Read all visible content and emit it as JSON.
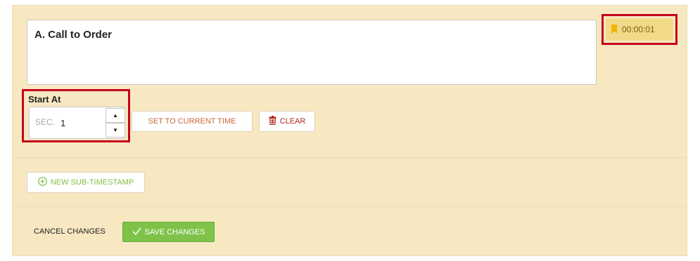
{
  "item": {
    "title": "A. Call to Order",
    "timestamp": "00:00:01"
  },
  "start_at": {
    "label": "Start At",
    "unit": "SEC.",
    "value": "1"
  },
  "buttons": {
    "set_current": "SET TO CURRENT TIME",
    "clear": "CLEAR",
    "new_sub": "NEW SUB-TIMESTAMP",
    "cancel": "CANCEL CHANGES",
    "save": "SAVE CHANGES"
  },
  "icons": {
    "bookmark": "bookmark-icon",
    "stepper_up": "caret-up-icon",
    "stepper_down": "caret-down-icon",
    "trash": "trash-icon",
    "plus_circle": "plus-circle-icon",
    "check": "check-icon"
  },
  "colors": {
    "panel_bg": "#f7e8c2",
    "badge_bg": "#f2d98a",
    "highlight": "#c4001a",
    "save_green": "#7ec24a",
    "clear_red": "#b3261e",
    "current_orange": "#c8663a"
  }
}
